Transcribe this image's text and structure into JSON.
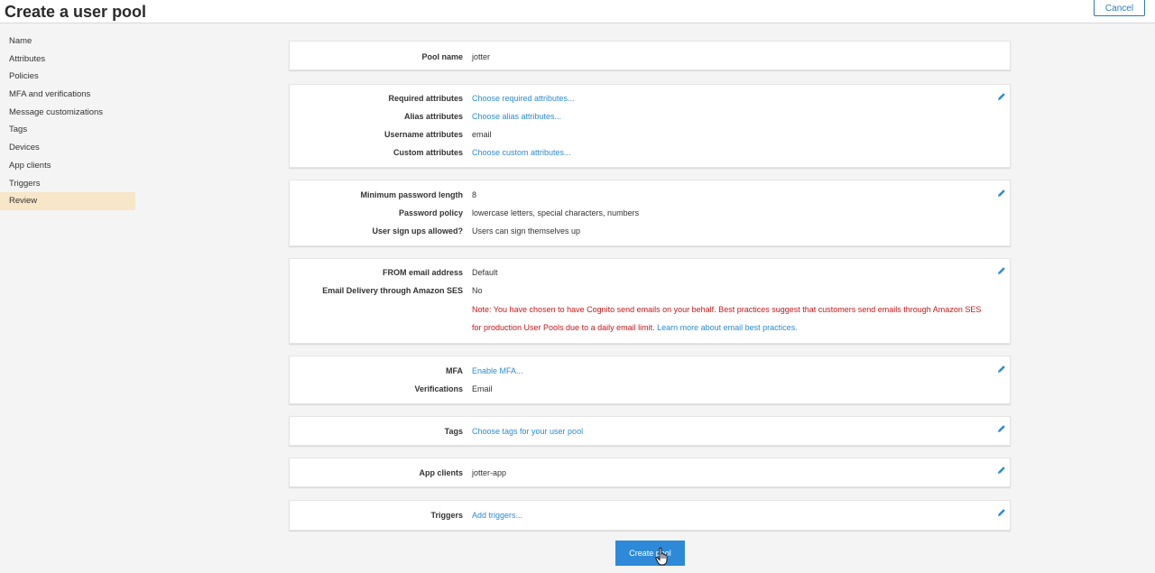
{
  "header": {
    "title": "Create a user pool",
    "cancel_label": "Cancel"
  },
  "sidebar": {
    "items": [
      {
        "label": "Name"
      },
      {
        "label": "Attributes"
      },
      {
        "label": "Policies"
      },
      {
        "label": "MFA and verifications"
      },
      {
        "label": "Message customizations"
      },
      {
        "label": "Tags"
      },
      {
        "label": "Devices"
      },
      {
        "label": "App clients"
      },
      {
        "label": "Triggers"
      },
      {
        "label": "Review"
      }
    ],
    "active_index": 9
  },
  "review": {
    "pool_name": {
      "label": "Pool name",
      "value": "jotter"
    },
    "attributes": {
      "required_label": "Required attributes",
      "required_value": "Choose required attributes...",
      "alias_label": "Alias attributes",
      "alias_value": "Choose alias attributes...",
      "username_label": "Username attributes",
      "username_value": "email",
      "custom_label": "Custom attributes",
      "custom_value": "Choose custom attributes..."
    },
    "policies": {
      "min_length_label": "Minimum password length",
      "min_length_value": "8",
      "policy_label": "Password policy",
      "policy_value": "lowercase letters, special characters, numbers",
      "signup_label": "User sign ups allowed?",
      "signup_value": "Users can sign themselves up"
    },
    "email": {
      "from_label": "FROM email address",
      "from_value": "Default",
      "ses_label": "Email Delivery through Amazon SES",
      "ses_value": "No",
      "note_line1": "Note: You have chosen to have Cognito send emails on your behalf. Best practices suggest that customers send emails through Amazon SES",
      "note_line2": "for production User Pools due to a daily email limit.",
      "note_link": "Learn more about email best practices."
    },
    "mfa": {
      "mfa_label": "MFA",
      "mfa_value": "Enable MFA...",
      "verifications_label": "Verifications",
      "verifications_value": "Email"
    },
    "tags": {
      "label": "Tags",
      "value": "Choose tags for your user pool"
    },
    "app_clients": {
      "label": "App clients",
      "value": "jotter-app"
    },
    "triggers": {
      "label": "Triggers",
      "value": "Add triggers..."
    }
  },
  "footer": {
    "create_label": "Create pool"
  },
  "colors": {
    "link": "#2b8bd0",
    "note": "#c41818",
    "active_nav": "#f7e6c7",
    "primary_button": "#2e8ad8"
  },
  "icons": {
    "edit": "pencil-icon",
    "cursor": "hand-pointer-icon"
  }
}
